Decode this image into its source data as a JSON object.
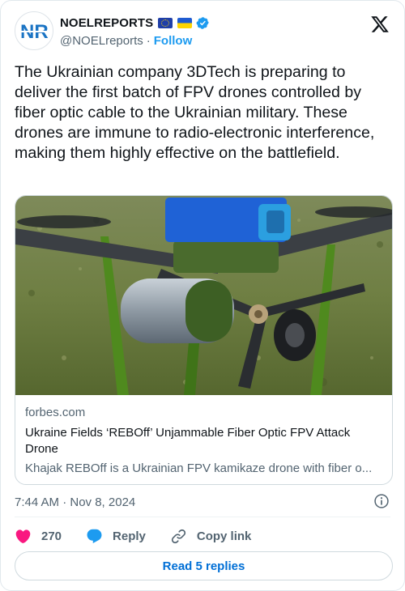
{
  "author": {
    "display_name": "NOELREPORTS",
    "handle": "@NOELreports",
    "separator": "·",
    "follow_label": "Follow",
    "avatar_text": "NR"
  },
  "tweet": {
    "text": "The Ukrainian company 3DTech is preparing to deliver the first batch of FPV drones controlled by fiber optic cable to the Ukrainian military. These drones are immune to radio-electronic interference, making them highly effective on the battlefield."
  },
  "link_card": {
    "domain": "forbes.com",
    "title": "Ukraine Fields ‘REBOff’ Unjammable Fiber Optic FPV Attack Drone",
    "description": "Khajak REBOff is a Ukrainian FPV kamikaze drone with fiber o..."
  },
  "meta": {
    "timestamp": "7:44 AM · Nov 8, 2024"
  },
  "actions": {
    "like_count": "270",
    "reply_label": "Reply",
    "copy_label": "Copy link"
  },
  "read_replies_label": "Read 5 replies",
  "colors": {
    "link_blue": "#1d9bf0",
    "like_red": "#f91880",
    "text_secondary": "#536471",
    "verified": "#1d9bf0"
  },
  "icons": [
    "x-logo-icon",
    "verified-badge-icon",
    "heart-icon",
    "reply-bubble-icon",
    "link-icon",
    "info-icon"
  ]
}
